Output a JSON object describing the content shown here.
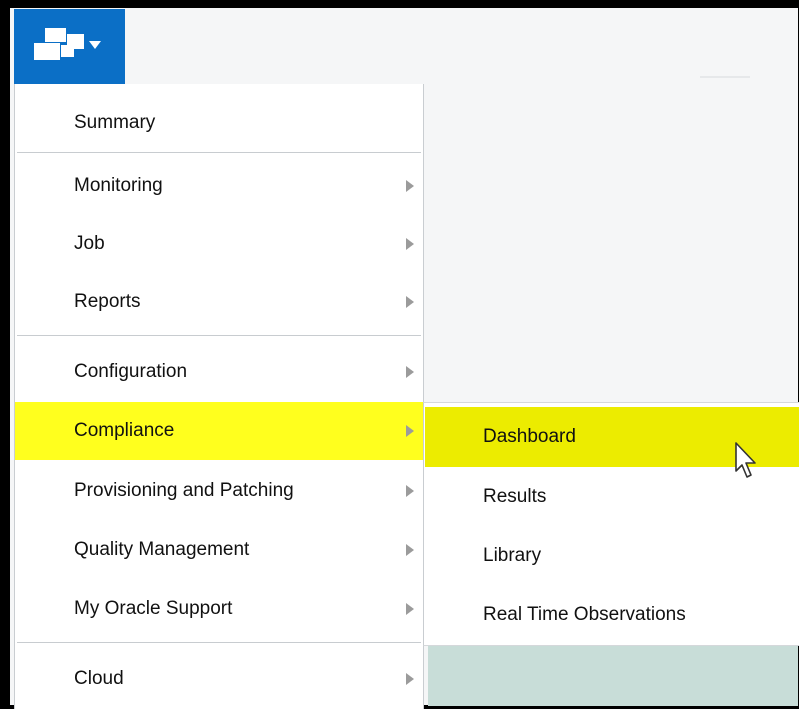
{
  "app_button": {
    "icon": "targets-menu-icon",
    "dropdown_icon": "caret-down-icon",
    "color": "#0b6fc6"
  },
  "main_menu": {
    "items": [
      {
        "label": "Summary",
        "has_submenu": false,
        "active": false
      },
      {
        "label": "Monitoring",
        "has_submenu": true,
        "active": false
      },
      {
        "label": "Job",
        "has_submenu": true,
        "active": false
      },
      {
        "label": "Reports",
        "has_submenu": true,
        "active": false
      },
      {
        "label": "Configuration",
        "has_submenu": true,
        "active": false
      },
      {
        "label": "Compliance",
        "has_submenu": true,
        "active": true
      },
      {
        "label": "Provisioning and Patching",
        "has_submenu": true,
        "active": false
      },
      {
        "label": "Quality Management",
        "has_submenu": true,
        "active": false
      },
      {
        "label": "My Oracle Support",
        "has_submenu": true,
        "active": false
      },
      {
        "label": "Cloud",
        "has_submenu": true,
        "active": false
      }
    ]
  },
  "sub_menu": {
    "items": [
      {
        "label": "Dashboard",
        "active": true
      },
      {
        "label": "Results",
        "active": false
      },
      {
        "label": "Library",
        "active": false
      },
      {
        "label": "Real Time Observations",
        "active": false
      }
    ]
  },
  "colors": {
    "highlight": "#ffff1e",
    "highlight_sub": "#ecec00",
    "arrow": "#9b9b9b"
  }
}
